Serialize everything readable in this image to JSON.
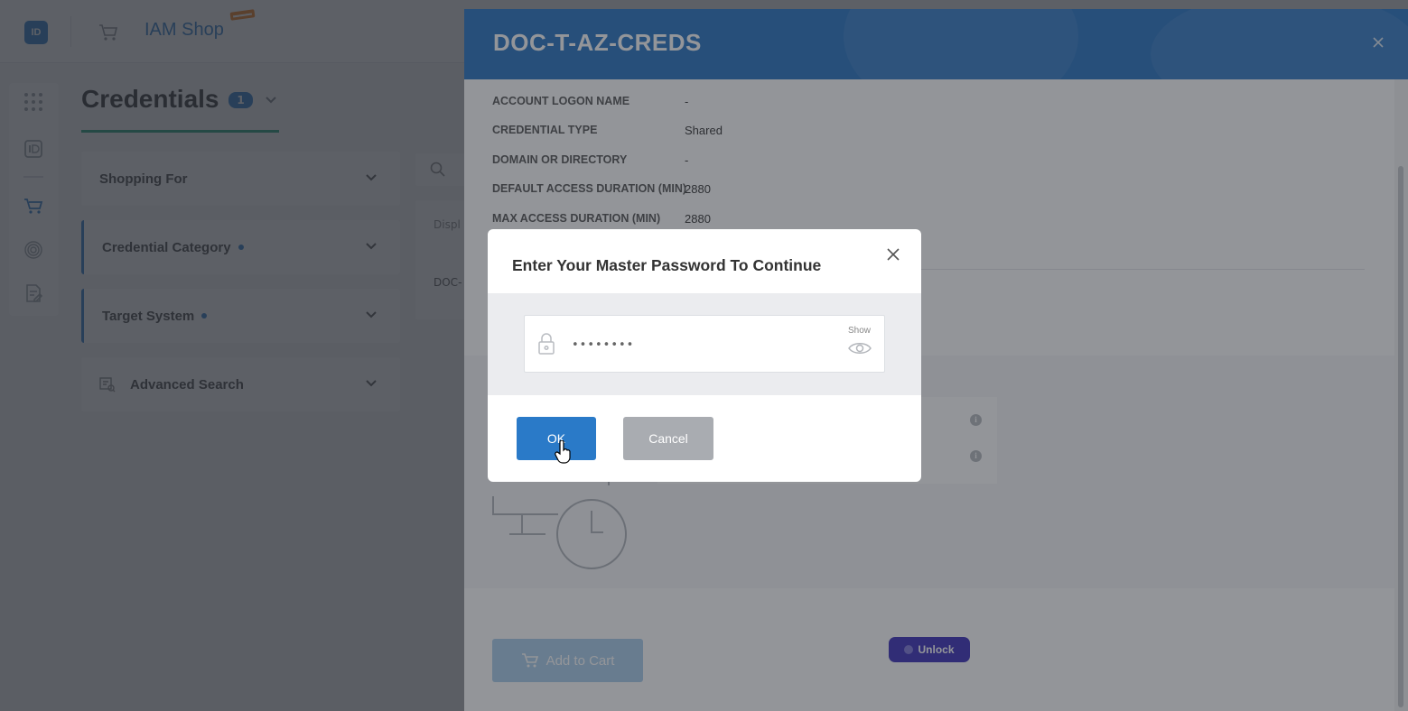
{
  "app": {
    "title": "IAM Shop",
    "logo_text": "ID",
    "brand_color": "#2a7ac8",
    "icons": [
      "apps-grid-icon",
      "id-card-icon",
      "cart-icon",
      "fingerprint-icon",
      "certificate-icon"
    ]
  },
  "page": {
    "title": "Credentials",
    "count": "1",
    "accent_color": "#1fa37a"
  },
  "filters": [
    {
      "label": "Shopping For",
      "active": false
    },
    {
      "label": "Credential Category",
      "active": true
    },
    {
      "label": "Target System",
      "active": true
    },
    {
      "label": "Advanced Search",
      "active": false
    }
  ],
  "panel": {
    "title": "DOC-T-AZ-CREDS",
    "header_color": "#2672c0",
    "details": [
      {
        "key": "ACCOUNT LOGON NAME",
        "value": "-"
      },
      {
        "key": "CREDENTIAL TYPE",
        "value": "Shared"
      },
      {
        "key": "DOMAIN OR DIRECTORY",
        "value": "-"
      },
      {
        "key": "DEFAULT ACCESS DURATION (MIN)",
        "value": "2880"
      },
      {
        "key": "MAX ACCESS DURATION (MIN)",
        "value": "2880"
      }
    ],
    "add_to_cart_label": "Add to Cart",
    "unlock_label": "Unlock",
    "unlock_color": "#3a2fb8"
  },
  "modal": {
    "title": "Enter Your Master Password To Continue",
    "password_value": "••••••••",
    "show_label": "Show",
    "ok_label": "OK",
    "cancel_label": "Cancel"
  }
}
